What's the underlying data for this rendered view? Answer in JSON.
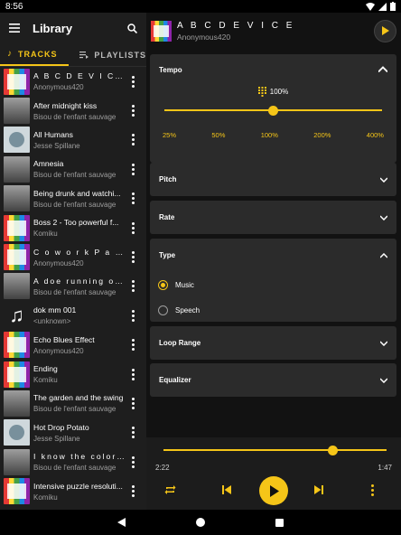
{
  "status": {
    "time": "8:56"
  },
  "library": {
    "title": "Library",
    "tabs": {
      "tracks": "TRACKS",
      "playlists": "PLAYLISTS"
    },
    "tracks": [
      {
        "title": "A B C D E V I C E",
        "artist": "Anonymous420",
        "thumb": "color"
      },
      {
        "title": "After midnight kiss",
        "artist": "Bisou de l'enfant sauvage",
        "thumb": "gray"
      },
      {
        "title": "All Humans",
        "artist": "Jesse Spillane",
        "thumb": "art"
      },
      {
        "title": "Amnesia",
        "artist": "Bisou de l'enfant sauvage",
        "thumb": "gray"
      },
      {
        "title": "Being drunk and watchi...",
        "artist": "Bisou de l'enfant sauvage",
        "thumb": "gray"
      },
      {
        "title": "Boss 2 - Too powerful f...",
        "artist": "Komiku",
        "thumb": "color"
      },
      {
        "title": "C o w o r k  P a r t ...",
        "artist": "Anonymous420",
        "thumb": "color"
      },
      {
        "title": "A doe running on the be...",
        "artist": "Bisou de l'enfant sauvage",
        "thumb": "gray"
      },
      {
        "title": "dok mm 001",
        "artist": "<unknown>",
        "thumb": "note"
      },
      {
        "title": "Echo Blues Effect",
        "artist": "Anonymous420",
        "thumb": "color"
      },
      {
        "title": "Ending",
        "artist": "Komiku",
        "thumb": "color"
      },
      {
        "title": "The garden and the swing",
        "artist": "Bisou de l'enfant sauvage",
        "thumb": "gray"
      },
      {
        "title": "Hot Drop Potato",
        "artist": "Jesse Spillane",
        "thumb": "art"
      },
      {
        "title": "I know the color of your ...",
        "artist": "Bisou de l'enfant sauvage",
        "thumb": "gray"
      },
      {
        "title": "Intensive puzzle resoluti...",
        "artist": "Komiku",
        "thumb": "color"
      }
    ]
  },
  "now_playing": {
    "title": "A B C D E V I C E",
    "artist": "Anonymous420"
  },
  "tempo": {
    "label": "Tempo",
    "value": "100%",
    "level": 0.5,
    "presets": [
      "25%",
      "50%",
      "100%",
      "200%",
      "400%"
    ]
  },
  "pitch": {
    "label": "Pitch"
  },
  "rate": {
    "label": "Rate"
  },
  "type": {
    "label": "Type",
    "options": [
      "Music",
      "Speech"
    ],
    "selected": "Music"
  },
  "loop_range": {
    "label": "Loop Range"
  },
  "equalizer": {
    "label": "Equalizer"
  },
  "player": {
    "position": "2:22",
    "duration": "1:47",
    "progress": 0.76
  },
  "colors": {
    "accent": "#f5c518",
    "surface": "#2b2b2b",
    "background": "#121212"
  }
}
